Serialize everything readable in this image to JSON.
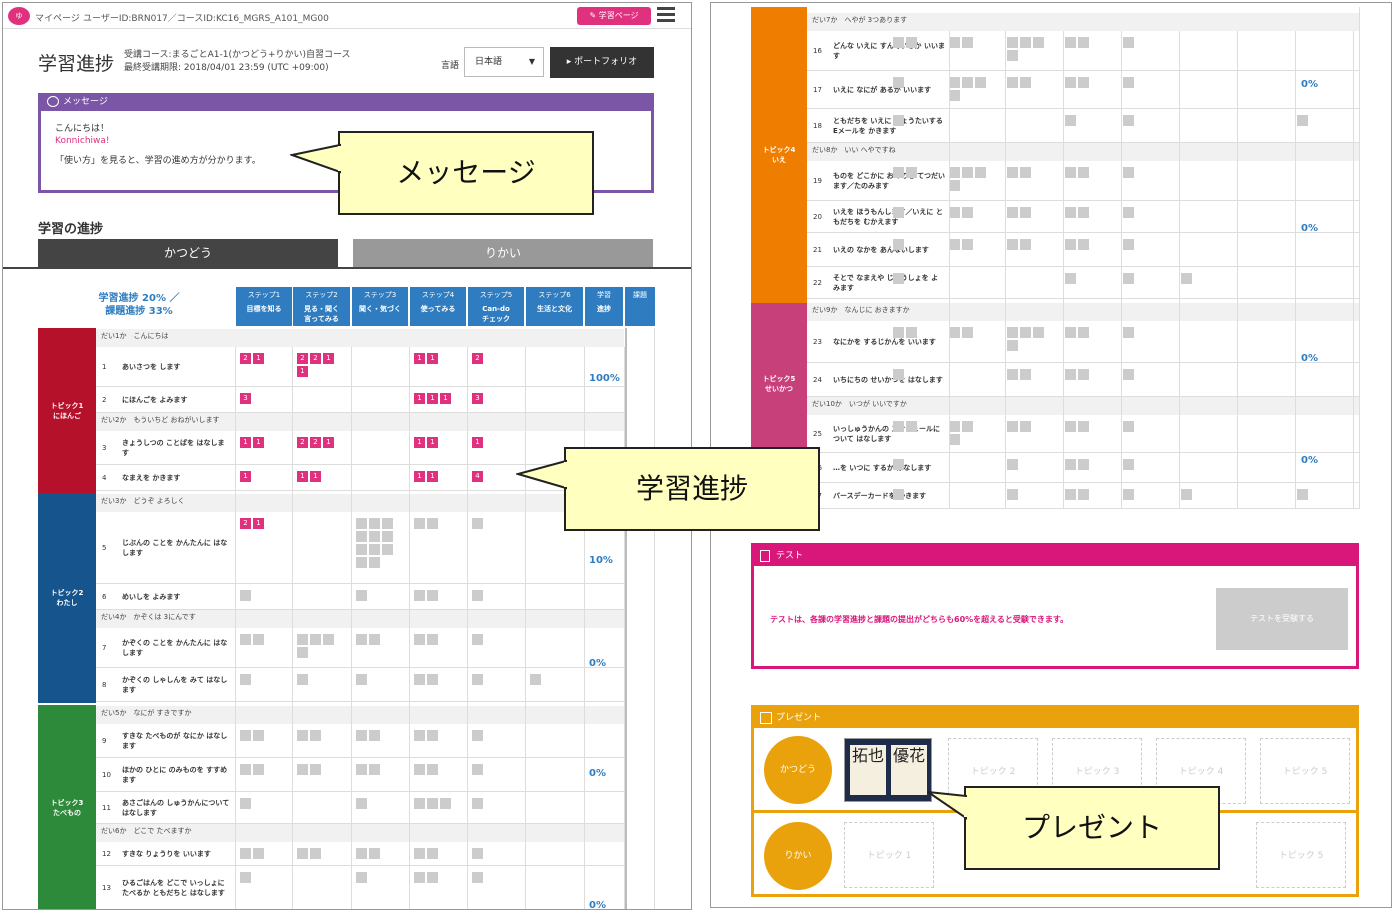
{
  "header": {
    "logo_text": "ゆ",
    "mypage": "マイページ",
    "ids": "ユーザーID:BRN017／コースID:KC16_MGRS_A101_MG00",
    "gakushu_page_btn": "学習ページ"
  },
  "page": {
    "title": "学習進捗",
    "course_line1": "受講コース:まるごとA1-1(かつどう+りかい)自習コース",
    "course_line2": "最終受講期限: 2018/04/01 23:59 (UTC +09:00)",
    "lang_label": "言語",
    "lang_value": "日本語",
    "portfolio_btn": "▸ ポートフォリオ"
  },
  "message": {
    "title": "メッセージ",
    "line1": "こんにちは！",
    "line2": "Konnichiwa!",
    "line3": "「使い方」を見ると、学習の進め方が分かります。"
  },
  "progress": {
    "section_title": "学習の進捗",
    "tab1": "かつどう",
    "tab2": "りかい",
    "summary1": "学習進捗 20% ／",
    "summary2": "課題進捗 33%",
    "steps": [
      {
        "l1": "ステップ1",
        "l2": "目標を知る"
      },
      {
        "l1": "ステップ2",
        "l2": "見る・聞く\n言ってみる"
      },
      {
        "l1": "ステップ3",
        "l2": "聞く・気づく"
      },
      {
        "l1": "ステップ4",
        "l2": "使ってみる"
      },
      {
        "l1": "ステップ5",
        "l2": "Can-do\nチェック"
      },
      {
        "l1": "ステップ6",
        "l2": "生活と文化"
      },
      {
        "l1": "学習",
        "l2": "進捗"
      },
      {
        "l1": "課題",
        "l2": ""
      }
    ],
    "topics_left": [
      {
        "label": "トピック1\nにほんご",
        "color": "#b5112a"
      },
      {
        "label": "トピック2\nわたし",
        "color": "#16548e"
      },
      {
        "label": "トピック3\nたべもの",
        "color": "#2d8a3a"
      }
    ],
    "lessons_left": [
      "だい1か　こんにちは",
      "だい2か　もういちど おねがいします",
      "だい3か　どうぞ よろしく",
      "だい4か　かぞくは 3にんです",
      "だい5か　なにが すきですか",
      "だい6か　どこで たべますか"
    ],
    "items_left": [
      {
        "n": "1",
        "t": "あいさつを します"
      },
      {
        "n": "2",
        "t": "にほんごを よみます"
      },
      {
        "n": "3",
        "t": "きょうしつの ことばを はなします"
      },
      {
        "n": "4",
        "t": "なまえを かきます"
      },
      {
        "n": "5",
        "t": "じぶんの ことを かんたんに はなします"
      },
      {
        "n": "6",
        "t": "めいしを よみます"
      },
      {
        "n": "7",
        "t": "かぞくの ことを かんたんに はなします"
      },
      {
        "n": "8",
        "t": "かぞくの しゃしんを みて はなします"
      },
      {
        "n": "9",
        "t": "すきな たべものが なにか はなします"
      },
      {
        "n": "10",
        "t": "ほかの ひとに のみものを すすめます"
      },
      {
        "n": "11",
        "t": "あさごはんの しゅうかんについて はなします"
      },
      {
        "n": "12",
        "t": "すきな りょうりを いいます"
      },
      {
        "n": "13",
        "t": "ひるごはんを どこで いっしょに たべるか ともだちと はなします"
      }
    ],
    "pct_left": [
      "100%",
      "10%",
      "0%",
      "0%",
      "0%"
    ],
    "topics_right": [
      {
        "label": "トピック4\nいえ",
        "color": "#ef7d00"
      },
      {
        "label": "トピック5\nせいかつ",
        "color": "#c8407a"
      }
    ],
    "lessons_right": [
      "だい7か　へやが 3つあります",
      "だい8か　いい へやですね",
      "だい9か　なんじに おきますか",
      "だい10か　いつが いいですか"
    ],
    "items_right": [
      {
        "n": "16",
        "t": "どんな いえに すんでいるか いいます"
      },
      {
        "n": "17",
        "t": "いえに なにが あるか いいます"
      },
      {
        "n": "18",
        "t": "ともだちを いえに しょうたいする Eメールを かきます"
      },
      {
        "n": "19",
        "t": "ものを どこかに おくのを てつだいます／たのみます"
      },
      {
        "n": "20",
        "t": "いえを ほうもんします／いえに ともだちを むかえます"
      },
      {
        "n": "21",
        "t": "いえの なかを あんないします"
      },
      {
        "n": "22",
        "t": "そとで なまえや じゅうしょを よみます"
      },
      {
        "n": "23",
        "t": "なにかを するじかんを いいます"
      },
      {
        "n": "24",
        "t": "いちにちの せいかつを はなします"
      },
      {
        "n": "25",
        "t": "いっしゅうかんの スケジュールについて はなします"
      },
      {
        "n": "26",
        "t": "…を いつに するか はなします"
      },
      {
        "n": "27",
        "t": "バースデーカードを かきます"
      }
    ],
    "pct_right": [
      "0%",
      "0%",
      "0%",
      "0%"
    ]
  },
  "test": {
    "title": "テスト",
    "message": "テストは、各課の学習進捗と課題の提出がどちらも60%を超えると受験できます。",
    "button": "テストを受験する"
  },
  "present": {
    "title": "プレゼント",
    "row1_label": "かつどう",
    "row2_label": "りかい",
    "card1": "拓也",
    "card2": "優花",
    "slots_row1": [
      "トピック 2",
      "トピック 3",
      "トピック 4",
      "トピック 5"
    ],
    "slots_row2": [
      "トピック 1",
      "トピック 5"
    ]
  },
  "callouts": {
    "message": "メッセージ",
    "progress": "学習進捗",
    "present": "プレゼント"
  },
  "colors": {
    "pink": "#e0317f",
    "purple": "#7b56a6",
    "blue": "#2f7dc0",
    "orange": "#e9a20b",
    "magenta": "#d9177a"
  }
}
